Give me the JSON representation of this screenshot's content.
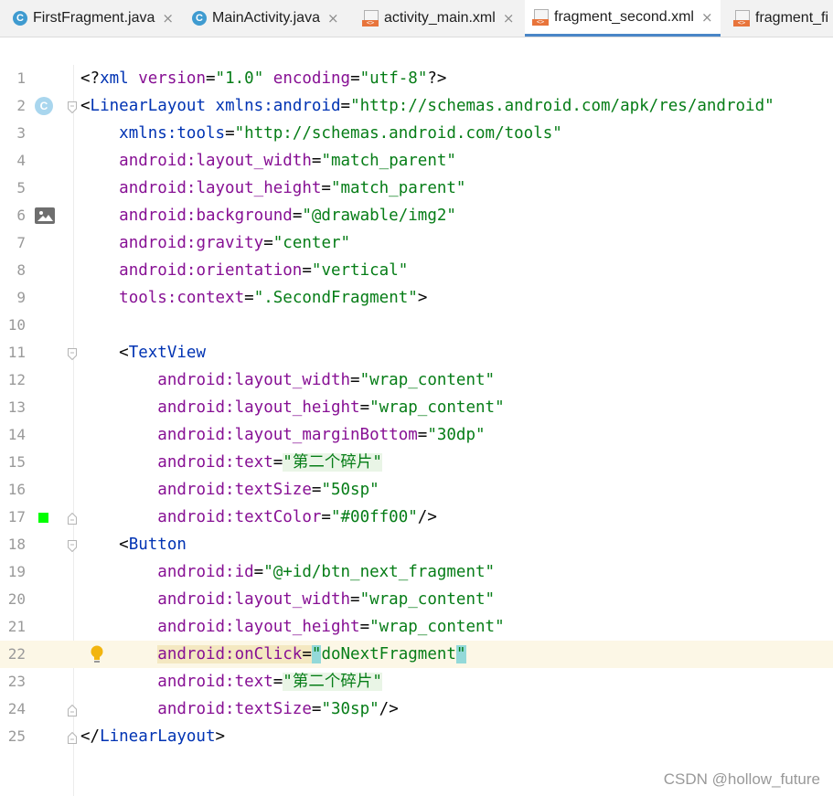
{
  "tabs": [
    {
      "label": "FirstFragment.java",
      "type": "class",
      "active": false
    },
    {
      "label": "MainActivity.java",
      "type": "class",
      "active": false
    },
    {
      "label": "activity_main.xml",
      "type": "xml",
      "active": false
    },
    {
      "label": "fragment_second.xml",
      "type": "xml",
      "active": true
    },
    {
      "label": "fragment_fi",
      "type": "xml",
      "active": false
    }
  ],
  "tab_close_glyph": "×",
  "gutter_icons": {
    "class_marker": "C",
    "image_preview": "image-icon",
    "color_swatch": "#00ff00",
    "intention": "lightbulb-icon"
  },
  "lines": [
    {
      "n": "1",
      "text": "<?xml version=\"1.0\" encoding=\"utf-8\"?>"
    },
    {
      "n": "2",
      "text": "<LinearLayout xmlns:android=\"http://schemas.android.com/apk/res/android\""
    },
    {
      "n": "3",
      "text": "    xmlns:tools=\"http://schemas.android.com/tools\""
    },
    {
      "n": "4",
      "text": "    android:layout_width=\"match_parent\""
    },
    {
      "n": "5",
      "text": "    android:layout_height=\"match_parent\""
    },
    {
      "n": "6",
      "text": "    android:background=\"@drawable/img2\""
    },
    {
      "n": "7",
      "text": "    android:gravity=\"center\""
    },
    {
      "n": "8",
      "text": "    android:orientation=\"vertical\""
    },
    {
      "n": "9",
      "text": "    tools:context=\".SecondFragment\">"
    },
    {
      "n": "10",
      "text": ""
    },
    {
      "n": "11",
      "text": "    <TextView"
    },
    {
      "n": "12",
      "text": "        android:layout_width=\"wrap_content\""
    },
    {
      "n": "13",
      "text": "        android:layout_height=\"wrap_content\""
    },
    {
      "n": "14",
      "text": "        android:layout_marginBottom=\"30dp\""
    },
    {
      "n": "15",
      "text": "        android:text=\"第二个碎片\""
    },
    {
      "n": "16",
      "text": "        android:textSize=\"50sp\""
    },
    {
      "n": "17",
      "text": "        android:textColor=\"#00ff00\"/>"
    },
    {
      "n": "18",
      "text": "    <Button"
    },
    {
      "n": "19",
      "text": "        android:id=\"@+id/btn_next_fragment\""
    },
    {
      "n": "20",
      "text": "        android:layout_width=\"wrap_content\""
    },
    {
      "n": "21",
      "text": "        android:layout_height=\"wrap_content\""
    },
    {
      "n": "22",
      "text": "        android:onClick=\"doNextFragment\""
    },
    {
      "n": "23",
      "text": "        android:text=\"第二个碎片\""
    },
    {
      "n": "24",
      "text": "        android:textSize=\"30sp\"/>"
    },
    {
      "n": "25",
      "text": "</LinearLayout>"
    }
  ],
  "current_line": "22",
  "watermark": "CSDN @hollow_future"
}
